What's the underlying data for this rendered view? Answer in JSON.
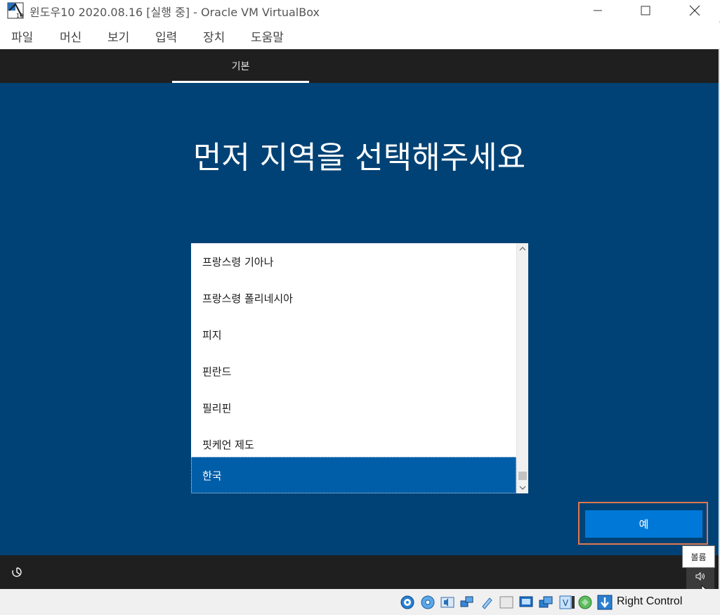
{
  "window": {
    "title": "윈도우10 2020.08.16 [실행 중] - Oracle VM VirtualBox"
  },
  "menu": {
    "items": [
      "파일",
      "머신",
      "보기",
      "입력",
      "장치",
      "도움말"
    ]
  },
  "setup": {
    "tab_label": "기본",
    "heading": "먼저 지역을 선택해주세요",
    "regions": [
      "프랑스령 기아나",
      "프랑스령 폴리네시아",
      "피지",
      "핀란드",
      "필리핀",
      "핏케언 제도",
      "한국"
    ],
    "selected_region": "한국",
    "yes_label": "예",
    "volume_tooltip": "볼륨"
  },
  "statusbar": {
    "host_key": "Right Control",
    "icons": [
      "hard-disk-icon",
      "optical-drive-icon",
      "audio-icon",
      "network-icon",
      "usb-icon",
      "shared-folders-icon",
      "display-icon",
      "recording-icon",
      "virtualization-icon",
      "mouse-integration-icon",
      "guest-additions-icon",
      "host-key-arrow-icon"
    ]
  },
  "colors": {
    "setup_background": "#004275",
    "selected_item": "#005ea8",
    "primary_button": "#0078d7",
    "highlight_border": "#e07850"
  }
}
